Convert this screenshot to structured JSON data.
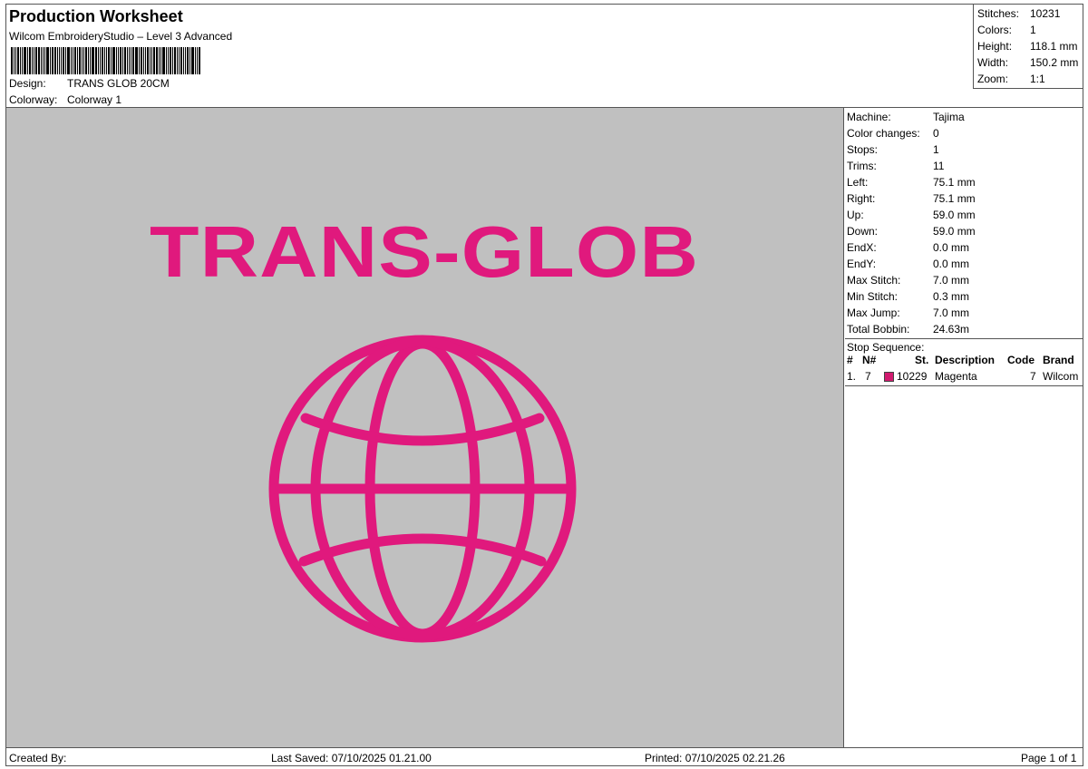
{
  "header": {
    "title": "Production Worksheet",
    "software": "Wilcom EmbroideryStudio – Level 3 Advanced",
    "design_label": "Design:",
    "design_value": "TRANS GLOB 20CM",
    "colorway_label": "Colorway:",
    "colorway_value": "Colorway 1"
  },
  "summary": [
    {
      "label": "Stitches:",
      "value": "10231"
    },
    {
      "label": "Colors:",
      "value": "1"
    },
    {
      "label": "Height:",
      "value": "118.1 mm"
    },
    {
      "label": "Width:",
      "value": "150.2 mm"
    },
    {
      "label": "Zoom:",
      "value": "1:1"
    }
  ],
  "design_preview": {
    "text": "TRANS-GLOB",
    "thread_color": "#e0197d",
    "background_color": "#c0c0c0",
    "graphic": "globe-icon"
  },
  "machine_info": [
    {
      "label": "Machine:",
      "value": "Tajima"
    },
    {
      "label": "Color changes:",
      "value": "0"
    },
    {
      "label": "Stops:",
      "value": "1"
    },
    {
      "label": "Trims:",
      "value": "11"
    },
    {
      "label": "Left:",
      "value": "75.1 mm"
    },
    {
      "label": "Right:",
      "value": "75.1 mm"
    },
    {
      "label": "Up:",
      "value": "59.0 mm"
    },
    {
      "label": "Down:",
      "value": "59.0 mm"
    },
    {
      "label": "EndX:",
      "value": "0.0 mm"
    },
    {
      "label": "EndY:",
      "value": "0.0 mm"
    },
    {
      "label": "Max Stitch:",
      "value": "7.0 mm"
    },
    {
      "label": "Min Stitch:",
      "value": "0.3 mm"
    },
    {
      "label": "Max Jump:",
      "value": "7.0 mm"
    },
    {
      "label": "Total Bobbin:",
      "value": "24.63m"
    }
  ],
  "stop_sequence": {
    "title": "Stop Sequence:",
    "columns": {
      "num": "#",
      "n_num": "N#",
      "st": "St.",
      "description": "Description",
      "code": "Code",
      "brand": "Brand"
    },
    "rows": [
      {
        "num": "1.",
        "n_num": "7",
        "color": "#d11a6f",
        "stitches": "10229",
        "description": "Magenta",
        "code": "7",
        "brand": "Wilcom"
      }
    ]
  },
  "footer": {
    "created_by": "Created By:",
    "last_saved": "Last Saved: 07/10/2025 01.21.00",
    "printed": "Printed: 07/10/2025 02.21.26",
    "page": "Page 1 of 1"
  }
}
